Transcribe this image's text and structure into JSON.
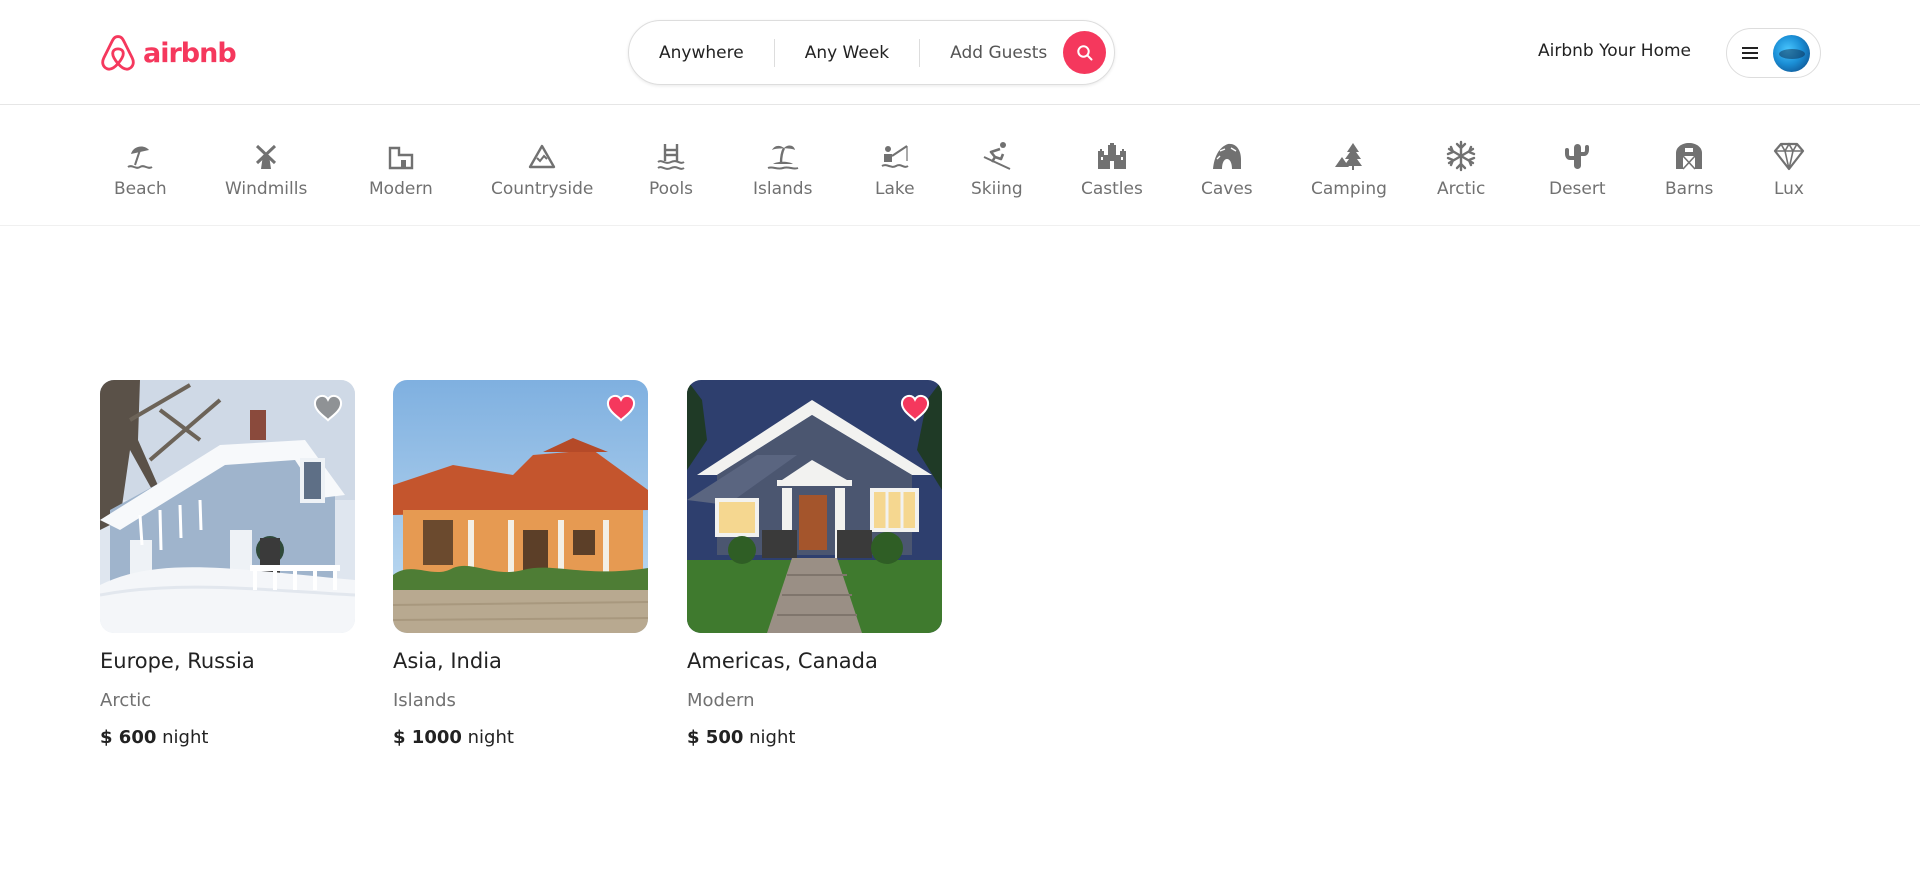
{
  "brand": {
    "name": "airbnb",
    "color": "#F5385D"
  },
  "search": {
    "where": "Anywhere",
    "when": "Any Week",
    "guests_placeholder": "Add Guests",
    "button_icon": "search-icon"
  },
  "header": {
    "host_link": "Airbnb Your Home",
    "menu_icon": "menu-icon",
    "avatar": "avatar"
  },
  "categories": [
    {
      "label": "Beach",
      "icon": "beach-icon"
    },
    {
      "label": "Windmills",
      "icon": "windmill-icon"
    },
    {
      "label": "Modern",
      "icon": "modern-building-icon"
    },
    {
      "label": "Countryside",
      "icon": "mountain-icon"
    },
    {
      "label": "Pools",
      "icon": "pool-icon"
    },
    {
      "label": "Islands",
      "icon": "island-icon"
    },
    {
      "label": "Lake",
      "icon": "lake-icon"
    },
    {
      "label": "Skiing",
      "icon": "skier-icon"
    },
    {
      "label": "Castles",
      "icon": "castle-icon"
    },
    {
      "label": "Caves",
      "icon": "cave-icon"
    },
    {
      "label": "Camping",
      "icon": "tent-icon"
    },
    {
      "label": "Arctic",
      "icon": "snowflake-icon"
    },
    {
      "label": "Desert",
      "icon": "cactus-icon"
    },
    {
      "label": "Barns",
      "icon": "barn-icon"
    },
    {
      "label": "Lux",
      "icon": "diamond-icon"
    }
  ],
  "listings": [
    {
      "location": "Europe, Russia",
      "category": "Arctic",
      "price": "$ 600",
      "unit": "night",
      "favorited": false
    },
    {
      "location": "Asia, India",
      "category": "Islands",
      "price": "$ 1000",
      "unit": "night",
      "favorited": true
    },
    {
      "location": "Americas, Canada",
      "category": "Modern",
      "price": "$ 500",
      "unit": "night",
      "favorited": true
    }
  ],
  "colors": {
    "accent": "#F5385D",
    "muted_text": "#717171",
    "border": "#dddddd"
  }
}
